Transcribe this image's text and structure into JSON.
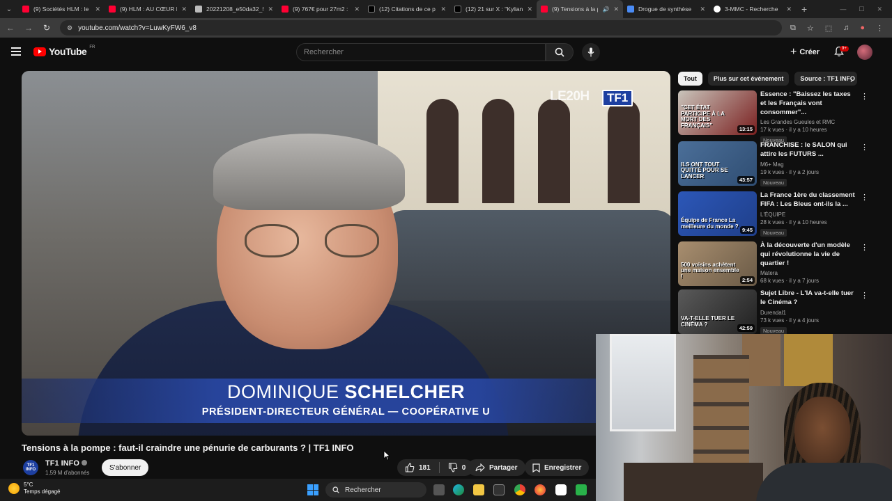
{
  "browser": {
    "tabs": [
      {
        "title": "(9) Sociétés HLM : le p",
        "color": "#ff0033"
      },
      {
        "title": "(9) HLM : AU CŒUR D",
        "color": "#ff0033"
      },
      {
        "title": "20221208_e50da32_5",
        "color": "#ffffff"
      },
      {
        "title": "(9) 767€ pour 27m2 :",
        "color": "#ff0033"
      },
      {
        "title": "(12) Citations de ce p",
        "color": "#000000"
      },
      {
        "title": "(12) 21 sur X : \"Kylian",
        "color": "#000000"
      },
      {
        "title": "(9) Tensions à la p",
        "color": "#ff0033"
      },
      {
        "title": "Drogue de synthèse",
        "color": "#4a8bf5"
      },
      {
        "title": "3-MMC - Recherche",
        "color": "#4285f4"
      }
    ],
    "url": "youtube.com/watch?v=LuwKyFW6_v8"
  },
  "header": {
    "logo_text": "YouTube",
    "country": "FR",
    "search_placeholder": "Rechercher",
    "create_label": "Créer",
    "notif_badge": "9+"
  },
  "video": {
    "overlay_brand": "LE20H",
    "overlay_channel": "TF1",
    "lower_third_first": "DOMINIQUE",
    "lower_third_last": "SCHELCHER",
    "lower_third_role": "PRÉSIDENT-DIRECTEUR GÉNÉRAL — COOPÉRATIVE U",
    "title": "Tensions à la pompe : faut-il craindre une pénurie de carburants ? | TF1 INFO",
    "channel": "TF1 INFO",
    "channel_avatar_top": "TF1",
    "channel_avatar_bottom": "INFO",
    "subscribers": "1,59 M d'abonnés",
    "subscribe_label": "S'abonner",
    "likes": "181",
    "dislikes": "0",
    "share_label": "Partager",
    "save_label": "Enregistrer"
  },
  "chips": [
    "Tout",
    "Plus sur cet événement",
    "Source : TF1 INFO"
  ],
  "suggestions": [
    {
      "title": "Essence : \"Baissez les taxes et les Français vont consommer\"...",
      "channel": "Les Grandes Gueules et RMC",
      "meta": "17 k vues · il y a 10 heures",
      "badge": "Nouveau",
      "duration": "13:15",
      "thumb_text": "\"CET ÉTAT PARTICIPE À LA MORT DES FRANÇAIS\"",
      "thumb_color": "#7a1f1f"
    },
    {
      "title": "FRANCHISE : le SALON qui attire les FUTURS ...",
      "channel": "M6+ Mag",
      "meta": "19 k vues · il y a 2 jours",
      "badge": "Nouveau",
      "duration": "43:57",
      "thumb_text": "ILS ONT TOUT QUITTÉ POUR SE LANCER",
      "thumb_color": "#2f4d72"
    },
    {
      "title": "La France 1ère du classement FIFA : Les Bleus ont-ils la ...",
      "channel": "L'ÉQUIPE",
      "meta": "28 k vues · il y a 10 heures",
      "badge": "Nouveau",
      "duration": "9:45",
      "thumb_text": "Équipe de France La meilleure du monde ?",
      "thumb_color": "#1f3f8a"
    },
    {
      "title": "À la découverte d'un modèle qui révolutionne la vie de quartier !",
      "channel": "Matera",
      "meta": "68 k vues · il y a 7 jours",
      "badge": "",
      "duration": "2:54",
      "thumb_text": "500 voisins achètent une maison ensemble !",
      "thumb_color": "#6a5a46"
    },
    {
      "title": "Sujet Libre - L'IA va-t-elle tuer le Cinéma ?",
      "channel": "Durendal1",
      "meta": "73 k vues · il y a 4 jours",
      "badge": "Nouveau",
      "duration": "42:59",
      "thumb_text": "VA-T-ELLE TUER LE CINÉMA ?",
      "thumb_color": "#3a3a3a"
    }
  ],
  "taskbar": {
    "temperature": "5°C",
    "weather": "Temps dégagé",
    "search_label": "Rechercher"
  },
  "colors": {
    "accent_red": "#ff0000",
    "tf1_blue": "#1d3fa0",
    "lower_third_blue": "#2846a0"
  }
}
